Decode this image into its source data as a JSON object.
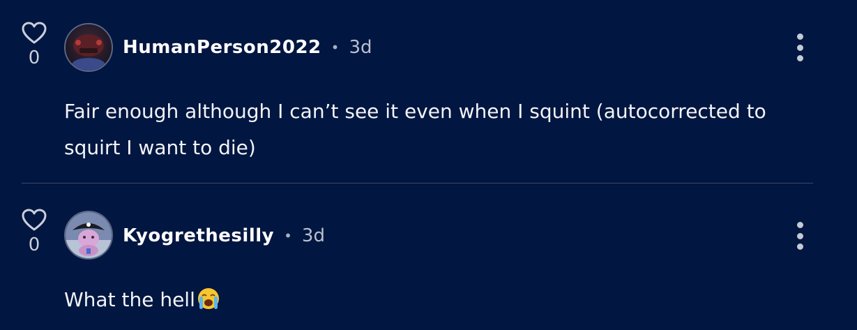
{
  "comments": [
    {
      "like_count": "0",
      "username": "HumanPerson2022",
      "separator": "•",
      "time": "3d",
      "text": "Fair enough although I can’t see it even when I squint (autocorrected to squirt I want to die)"
    },
    {
      "like_count": "0",
      "username": "Kyogrethesilly",
      "separator": "•",
      "time": "3d",
      "text": "What the hell"
    }
  ],
  "icons": {
    "like": "heart-outline-icon",
    "more": "vertical-ellipsis-icon",
    "emoji": "loudly-crying-face-emoji"
  },
  "colors": {
    "background": "#011640",
    "text": "#ffffff",
    "muted": "#b9c0cf",
    "divider": "#3e4a68"
  }
}
